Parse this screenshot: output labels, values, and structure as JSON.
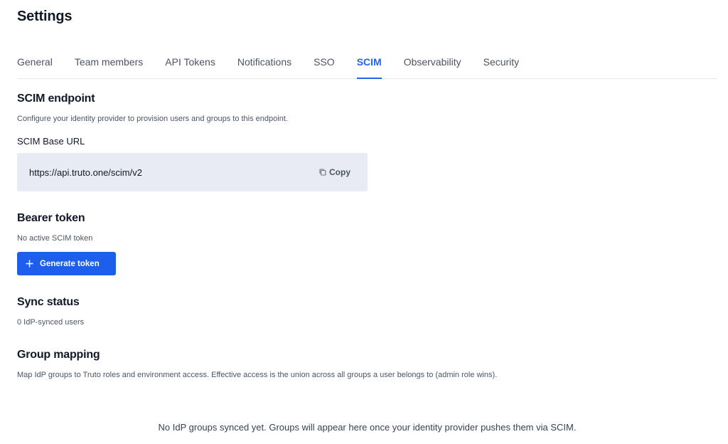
{
  "header": {
    "title": "Settings"
  },
  "tabs": [
    {
      "label": "General",
      "active": false
    },
    {
      "label": "Team members",
      "active": false
    },
    {
      "label": "API Tokens",
      "active": false
    },
    {
      "label": "Notifications",
      "active": false
    },
    {
      "label": "SSO",
      "active": false
    },
    {
      "label": "SCIM",
      "active": true
    },
    {
      "label": "Observability",
      "active": false
    },
    {
      "label": "Security",
      "active": false
    }
  ],
  "endpoint": {
    "title": "SCIM endpoint",
    "description": "Configure your identity provider to provision users and groups to this endpoint.",
    "url_label": "SCIM Base URL",
    "url_value": "https://api.truto.one/scim/v2",
    "copy_label": "Copy",
    "copy_icon": "copy-icon"
  },
  "bearer": {
    "title": "Bearer token",
    "status": "No active SCIM token",
    "generate_label": "Generate token",
    "generate_icon": "plus-icon"
  },
  "sync": {
    "title": "Sync status",
    "count_text": "0 IdP-synced users"
  },
  "group_mapping": {
    "title": "Group mapping",
    "description": "Map IdP groups to Truto roles and environment access. Effective access is the union across all groups a user belongs to (admin role wins).",
    "empty_text": "No IdP groups synced yet. Groups will appear here once your identity provider pushes them via SCIM."
  },
  "colors": {
    "accent": "#2563eb",
    "button": "#1d5eed",
    "url_box": "#e8ebf3",
    "border": "#e5e7eb"
  }
}
